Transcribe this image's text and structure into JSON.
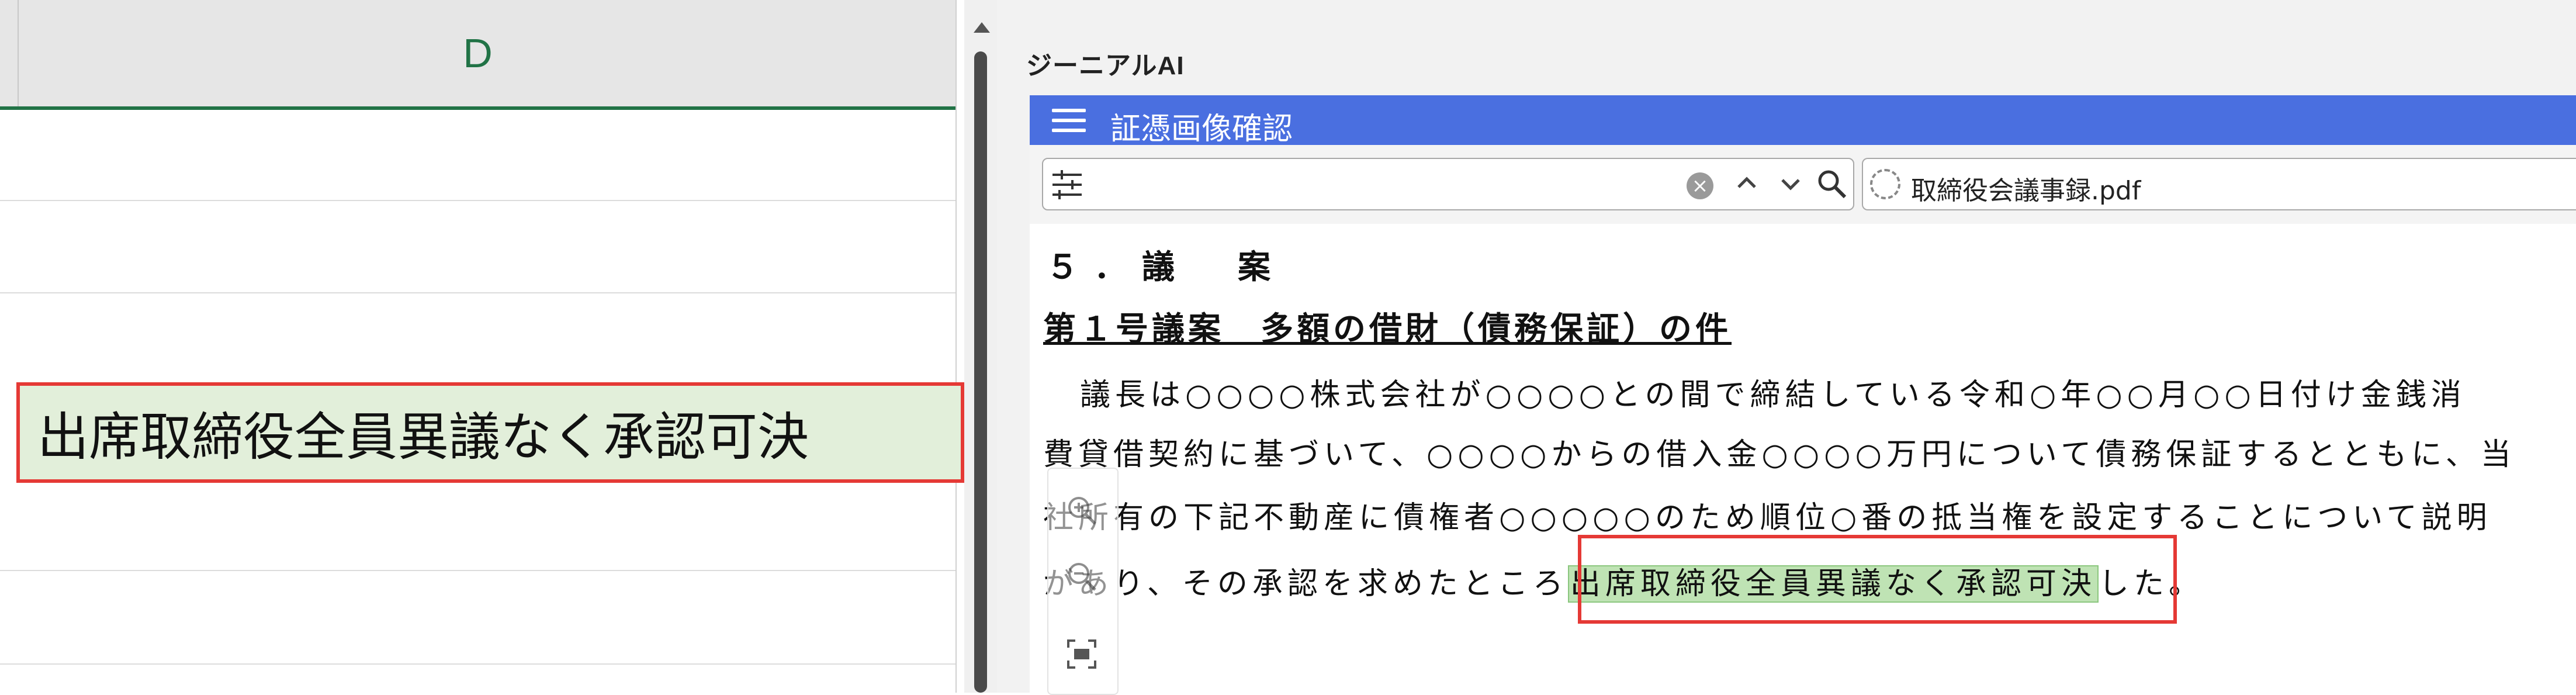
{
  "spreadsheet": {
    "column_header": "D",
    "selected_cell_text": "出席取締役全員異議なく承認可決"
  },
  "viewer": {
    "app_title": "ジーニアルAI",
    "panel_title": "証憑画像確認",
    "search": {
      "value": "",
      "placeholder": ""
    },
    "file_name": "取締役会議事録.pdf",
    "icons": [
      "menu-icon",
      "filter-icon",
      "clear-icon",
      "chevron-up-icon",
      "chevron-down-icon",
      "search-icon",
      "loading-icon",
      "zoom-in-icon",
      "zoom-out-icon",
      "fit-screen-icon"
    ]
  },
  "document": {
    "section_heading": "５．議　案",
    "agenda_title": "第１号議案　多額の借財（債務保証）の件",
    "line1": "議長は○○○○株式会社が○○○○との間で締結している令和○年○○月○○日付け金銭消",
    "line2": "費貸借契約に基づいて、○○○○からの借入金○○○○万円について債務保証するとともに、当",
    "line3": "社所有の下記不動産に債権者○○○○○のため順位○番の抵当権を設定することについて説明",
    "line4_prefix": "があり、その承認を求めたところ",
    "line4_highlight": "出席取締役全員異議なく承認可決",
    "line4_suffix": "した。"
  },
  "colors": {
    "excel_green": "#217346",
    "title_bar_blue": "#4a6fe0",
    "highlight_red": "#e53935",
    "cell_fill": "#e2efda",
    "text_highlight": "#bfe3b4"
  }
}
